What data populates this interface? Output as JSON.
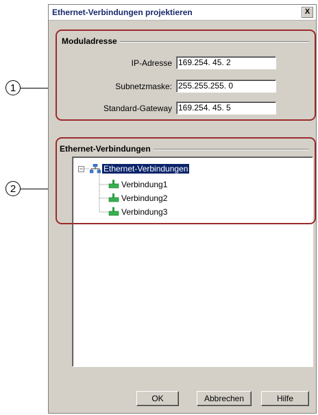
{
  "dialog": {
    "title": "Ethernet-Verbindungen projektieren",
    "close_label": "X"
  },
  "module_address": {
    "group_title": "Moduladresse",
    "fields": [
      {
        "label": "IP-Adresse",
        "value": "169.254. 45.  2"
      },
      {
        "label": "Subnetzmaske:",
        "value": "255.255.255.  0"
      },
      {
        "label": "Standard-Gateway",
        "value": "169.254. 45.  5"
      }
    ]
  },
  "connections": {
    "group_title": "Ethernet-Verbindungen",
    "root": {
      "label": "Ethernet-Verbindungen",
      "expander": "−"
    },
    "items": [
      {
        "label": "Verbindung1"
      },
      {
        "label": "Verbindung2"
      },
      {
        "label": "Verbindung3"
      }
    ]
  },
  "buttons": {
    "ok": "OK",
    "cancel": "Abbrechen",
    "help": "Hilfe"
  },
  "callouts": [
    "1",
    "2"
  ],
  "colors": {
    "dialog_bg": "#d4d0c8",
    "callout_border": "#9b2b2b",
    "selection": "#0a246a"
  },
  "icons": {
    "root": "network-icon",
    "item": "connection-icon"
  }
}
